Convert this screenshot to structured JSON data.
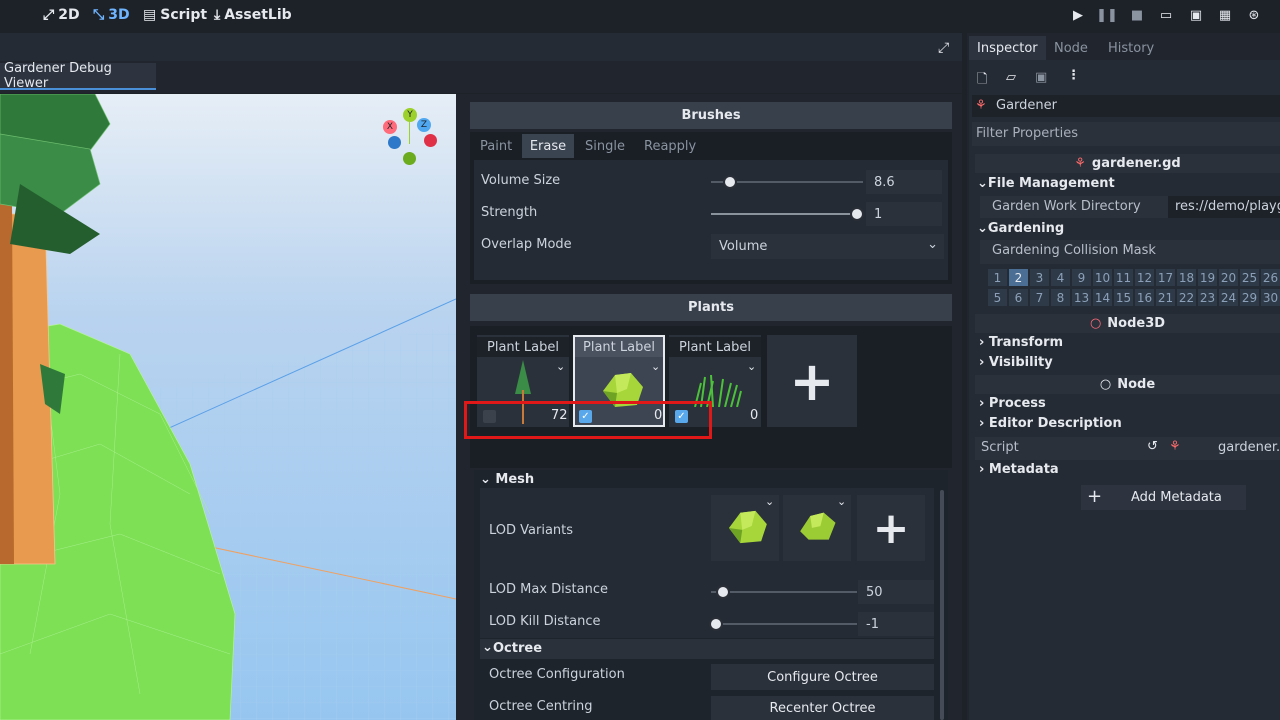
{
  "topbar": {
    "workspaces": [
      "2D",
      "3D",
      "Script",
      "AssetLib"
    ],
    "workspace_icons": [
      "2d-icon",
      "3d-icon",
      "script-icon",
      "assetlib-icon"
    ],
    "active_workspace": "3D",
    "accent_color": "#6fb5ff"
  },
  "viewport": {
    "tab_label": "Gardener Debug Viewer",
    "gizmo": {
      "x": "X",
      "y": "Y",
      "z": "Z"
    }
  },
  "brushes": {
    "title": "Brushes",
    "tabs": [
      "Paint",
      "Erase",
      "Single",
      "Reapply"
    ],
    "selected_tab": "Erase",
    "volume_size_label": "Volume Size",
    "volume_size_value": "8.6",
    "volume_size_fraction": 0.12,
    "strength_label": "Strength",
    "strength_value": "1",
    "strength_fraction": 1.0,
    "overlap_label": "Overlap Mode",
    "overlap_value": "Volume"
  },
  "plants": {
    "title": "Plants",
    "cards": [
      {
        "label": "Plant Label",
        "count": "72",
        "checked": false,
        "icon": "tree-icon"
      },
      {
        "label": "Plant Label",
        "count": "0",
        "checked": true,
        "icon": "bush-icon"
      },
      {
        "label": "Plant Label",
        "count": "0",
        "checked": true,
        "icon": "grass-icon"
      }
    ],
    "add_label": "+"
  },
  "plant_settings": {
    "mesh_section": "Mesh",
    "lod_variants_label": "LOD Variants",
    "lod_max_label": "LOD Max Distance",
    "lod_max_value": "50",
    "lod_kill_label": "LOD Kill Distance",
    "lod_kill_value": "-1",
    "octree_section": "Octree",
    "octree_config_label": "Octree Configuration",
    "octree_config_button": "Configure Octree",
    "octree_centring_label": "Octree Centring",
    "octree_centring_button": "Recenter Octree"
  },
  "inspector": {
    "tabs": [
      "Inspector",
      "Node",
      "History"
    ],
    "selected_tab": "Inspector",
    "node_name": "Gardener",
    "filter_placeholder": "Filter Properties",
    "script_file": "gardener.gd",
    "file_management": "File Management",
    "garden_work_dir_label": "Garden Work Directory",
    "garden_work_dir_value": "res://demo/playg",
    "gardening": "Gardening",
    "collision_mask_label": "Gardening Collision Mask",
    "layers_row1": [
      "1",
      "2",
      "3",
      "4",
      "9",
      "10",
      "11",
      "12",
      "17",
      "18",
      "19",
      "20",
      "25",
      "26"
    ],
    "layers_row2": [
      "5",
      "6",
      "7",
      "8",
      "13",
      "14",
      "15",
      "16",
      "21",
      "22",
      "23",
      "24",
      "29",
      "30"
    ],
    "active_layer": "2",
    "node3d": "Node3D",
    "transform": "Transform",
    "visibility": "Visibility",
    "node": "Node",
    "process": "Process",
    "editor_description": "Editor Description",
    "script_label": "Script",
    "script_value": "gardener.g",
    "metadata": "Metadata",
    "add_metadata": "Add Metadata"
  }
}
